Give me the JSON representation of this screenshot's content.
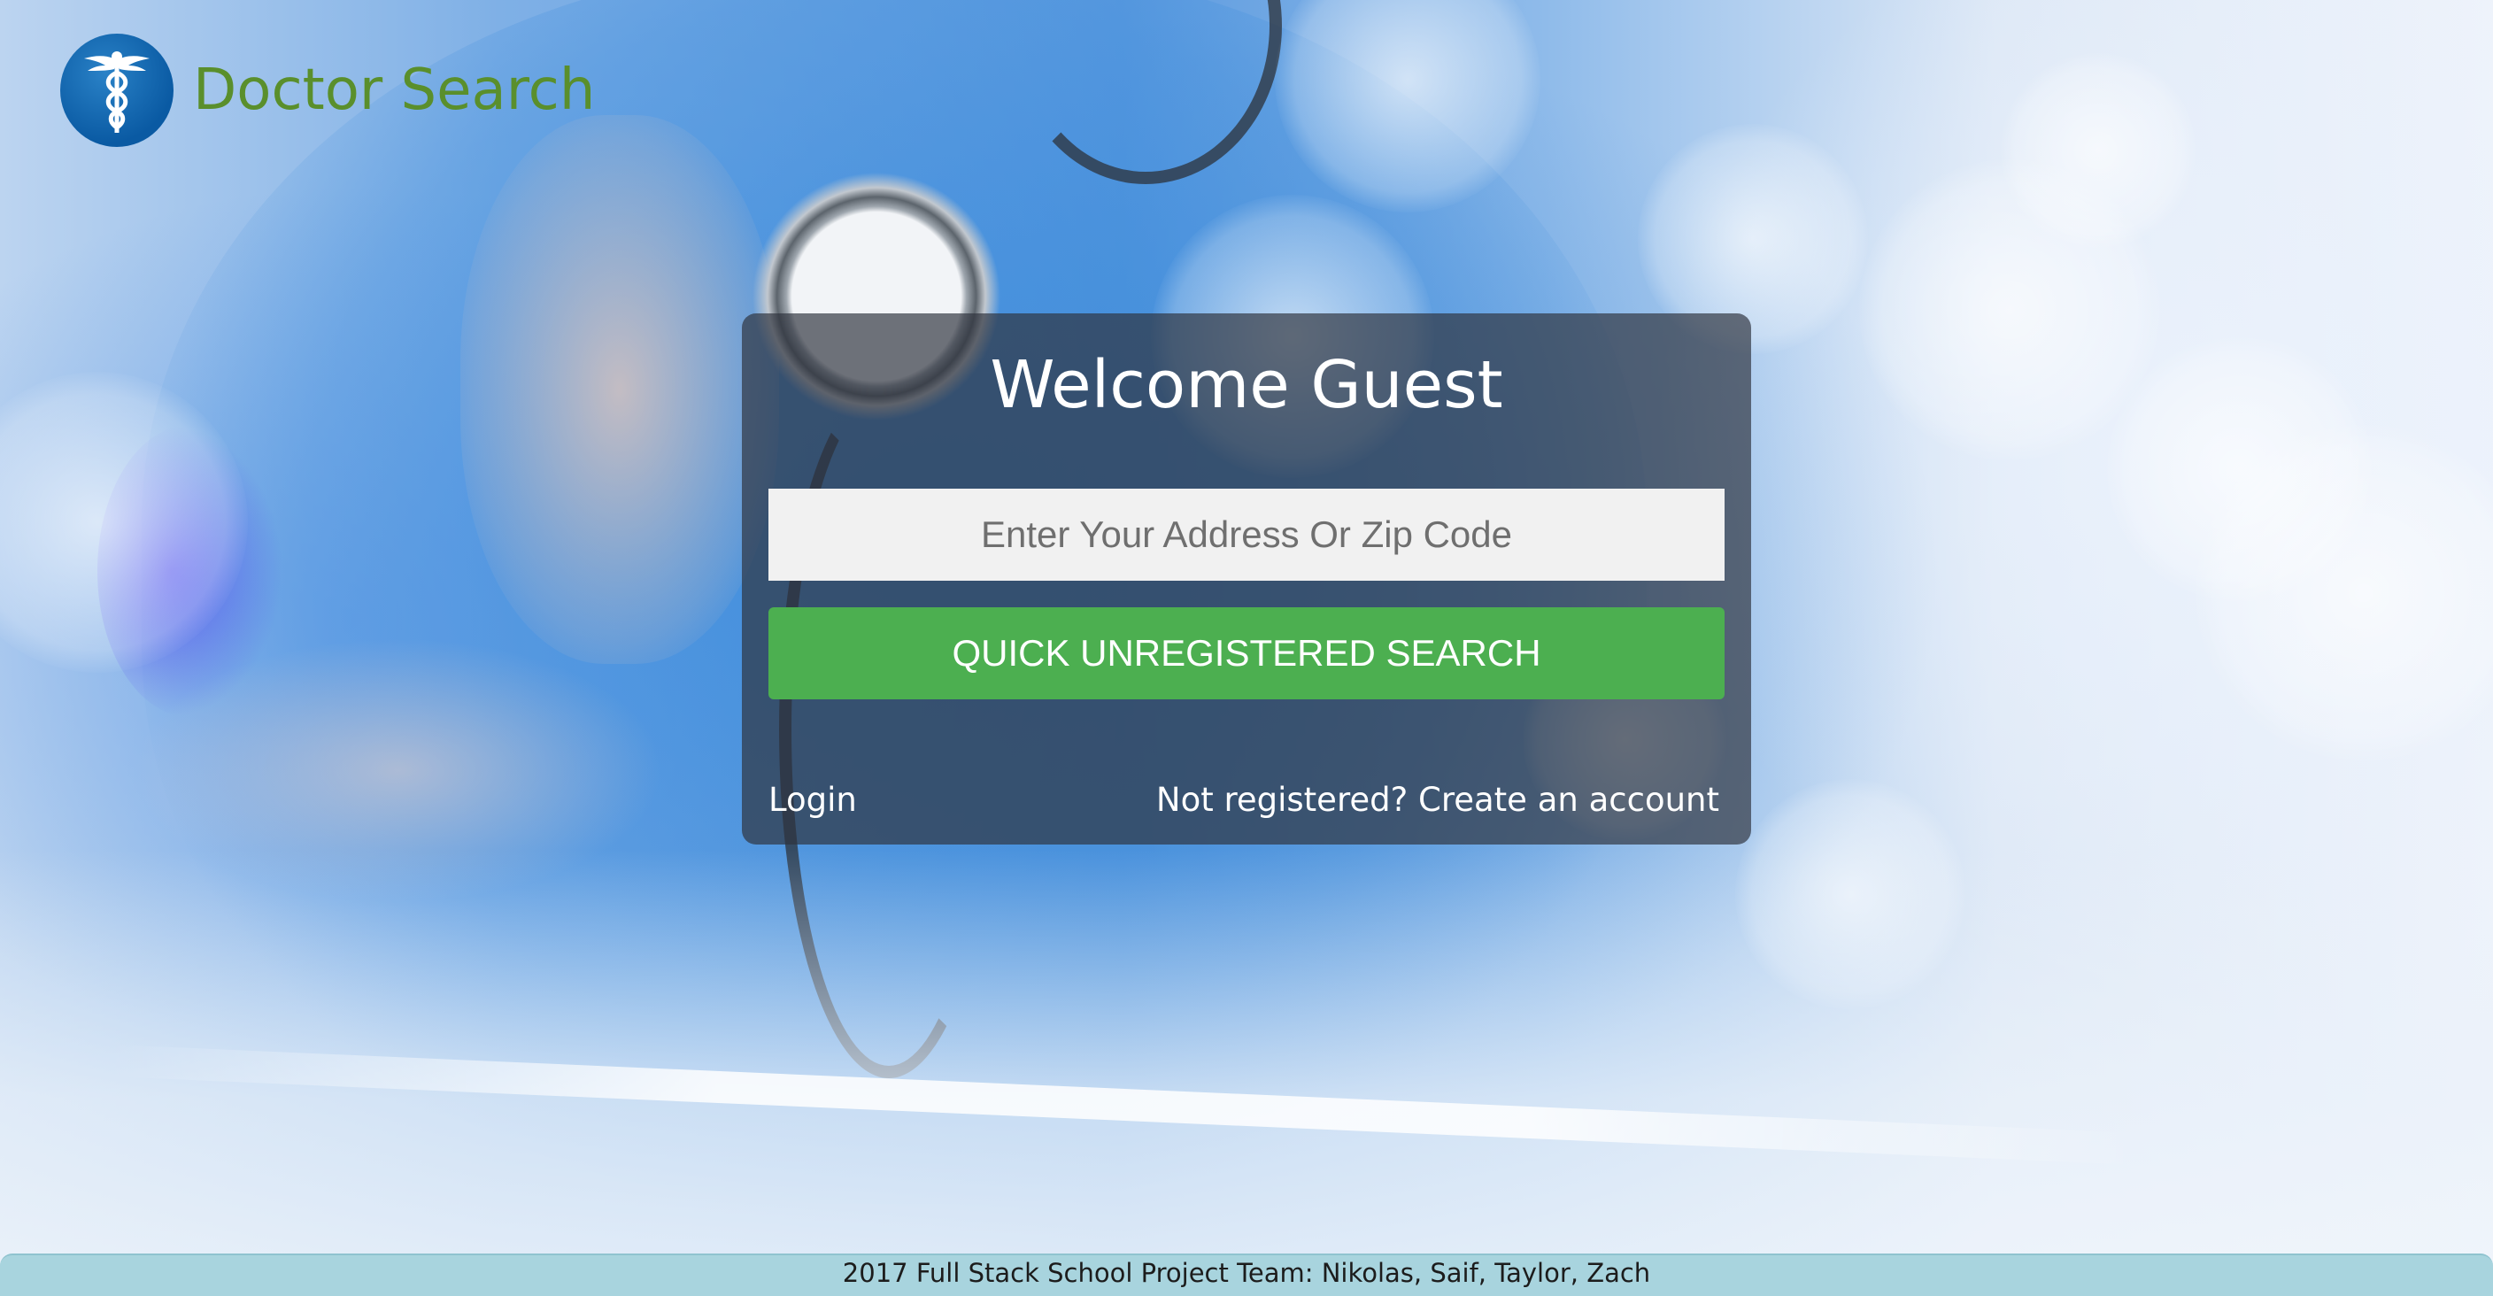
{
  "brand": {
    "title": "Doctor Search",
    "logo_icon": "caduceus-icon",
    "title_color": "#5a8f2c",
    "logo_color": "#0a5aa3"
  },
  "welcome_panel": {
    "title": "Welcome Guest",
    "address_input": {
      "placeholder": "Enter Your Address Or Zip Code",
      "value": ""
    },
    "search_button_label": "QUICK UNREGISTERED SEARCH",
    "search_button_color": "#4caf50",
    "login_link": "Login",
    "register_link": "Not registered? Create an account"
  },
  "footer": {
    "text": "2017 Full Stack School Project Team: Nikolas, Saif, Taylor, Zach",
    "background_color": "#a8d4de"
  }
}
